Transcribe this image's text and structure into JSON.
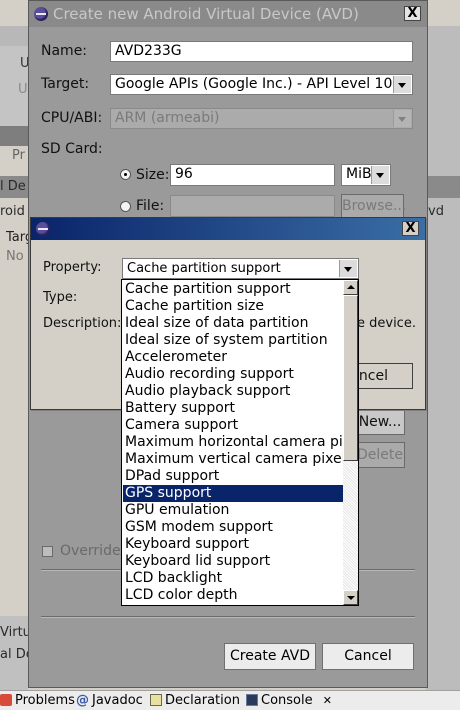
{
  "background": {
    "fragments": [
      "U",
      "U",
      "Pr",
      "l De",
      "roid V",
      "Targ",
      "No",
      "vd",
      "Virtu",
      "al De"
    ],
    "bottom_tabs": [
      {
        "label": "Problems",
        "icon": "problems-icon"
      },
      {
        "label": "Javadoc",
        "icon": "at-icon"
      },
      {
        "label": "Declaration",
        "icon": "declaration-icon"
      },
      {
        "label": "Console",
        "icon": "console-icon",
        "close": "✕"
      }
    ]
  },
  "avd_dialog": {
    "title": "Create new Android Virtual Device (AVD)",
    "close_glyph": "X",
    "name_label": "Name:",
    "name_value": "AVD233G",
    "target_label": "Target:",
    "target_value": "Google APIs (Google Inc.) - API Level 10",
    "cpu_label": "CPU/ABI:",
    "cpu_value": "ARM (armeabi)",
    "sdcard_label": "SD Card:",
    "size_label": "Size:",
    "size_value": "96",
    "size_unit": "MiB",
    "file_label": "File:",
    "file_value": "",
    "browse_label": "Browse...",
    "new_label": "New...",
    "delete_label": "Delete",
    "override_label": "Override t",
    "create_label": "Create AVD",
    "cancel_label": "Cancel"
  },
  "property_dialog": {
    "close_glyph": "X",
    "property_label": "Property:",
    "property_value": "Cache partition support",
    "type_label": "Type:",
    "description_label": "Description:",
    "description_tail": "e device.",
    "cancel_partial": "ncel"
  },
  "property_options": {
    "selected_index": 12,
    "items": [
      "Cache partition support",
      "Cache partition size",
      "Ideal size of data partition",
      "Ideal size of system partition",
      "Accelerometer",
      "Audio recording support",
      "Audio playback support",
      "Battery support",
      "Camera support",
      "Maximum horizontal camera pixels",
      "Maximum vertical camera pixels",
      "DPad support",
      "GPS support",
      "GPU emulation",
      "GSM modem support",
      "Keyboard support",
      "Keyboard lid support",
      "LCD backlight",
      "LCD color depth"
    ]
  }
}
